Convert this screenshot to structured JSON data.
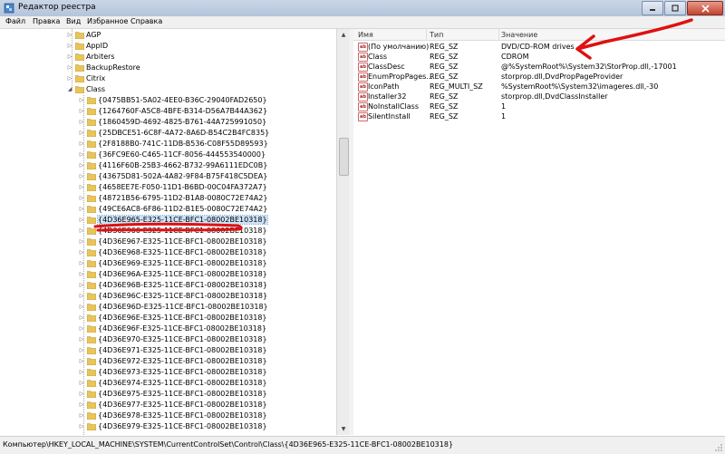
{
  "window": {
    "title": "Редактор реестра"
  },
  "menu": [
    "Файл",
    "Правка",
    "Вид",
    "Избранное",
    "Справка"
  ],
  "tree": {
    "items": [
      {
        "label": "AGP"
      },
      {
        "label": "AppID"
      },
      {
        "label": "Arbiters"
      },
      {
        "label": "BackupRestore"
      },
      {
        "label": "Citrix"
      },
      {
        "label": "Class"
      },
      {
        "label": "{0475BB51-5A02-4EE0-B36C-29040FAD2650}"
      },
      {
        "label": "{1264760F-A5C8-4BFE-B314-D56A7B44A362}"
      },
      {
        "label": "{1860459D-4692-4825-B761-44A725991050}"
      },
      {
        "label": "{25DBCE51-6C8F-4A72-8A6D-B54C2B4FC835}"
      },
      {
        "label": "{2F8188B0-741C-11DB-B536-C08F55D89593}"
      },
      {
        "label": "{36FC9E60-C465-11CF-8056-444553540000}"
      },
      {
        "label": "{4116F60B-25B3-4662-B732-99A6111EDC0B}"
      },
      {
        "label": "{43675D81-502A-4A82-9F84-B75F418C5DEA}"
      },
      {
        "label": "{4658EE7E-F050-11D1-B6BD-00C04FA372A7}"
      },
      {
        "label": "{48721B56-6795-11D2-B1A8-0080C72E74A2}"
      },
      {
        "label": "{49CE6AC8-6F86-11D2-B1E5-0080C72E74A2}"
      },
      {
        "label": "{4D36E965-E325-11CE-BFC1-08002BE10318}"
      },
      {
        "label": "{4D36E966-E325-11CE-BFC1-08002BE10318}"
      },
      {
        "label": "{4D36E967-E325-11CE-BFC1-08002BE10318}"
      },
      {
        "label": "{4D36E968-E325-11CE-BFC1-08002BE10318}"
      },
      {
        "label": "{4D36E969-E325-11CE-BFC1-08002BE10318}"
      },
      {
        "label": "{4D36E96A-E325-11CE-BFC1-08002BE10318}"
      },
      {
        "label": "{4D36E96B-E325-11CE-BFC1-08002BE10318}"
      },
      {
        "label": "{4D36E96C-E325-11CE-BFC1-08002BE10318}"
      },
      {
        "label": "{4D36E96D-E325-11CE-BFC1-08002BE10318}"
      },
      {
        "label": "{4D36E96E-E325-11CE-BFC1-08002BE10318}"
      },
      {
        "label": "{4D36E96F-E325-11CE-BFC1-08002BE10318}"
      },
      {
        "label": "{4D36E970-E325-11CE-BFC1-08002BE10318}"
      },
      {
        "label": "{4D36E971-E325-11CE-BFC1-08002BE10318}"
      },
      {
        "label": "{4D36E972-E325-11CE-BFC1-08002BE10318}"
      },
      {
        "label": "{4D36E973-E325-11CE-BFC1-08002BE10318}"
      },
      {
        "label": "{4D36E974-E325-11CE-BFC1-08002BE10318}"
      },
      {
        "label": "{4D36E975-E325-11CE-BFC1-08002BE10318}"
      },
      {
        "label": "{4D36E977-E325-11CE-BFC1-08002BE10318}"
      },
      {
        "label": "{4D36E978-E325-11CE-BFC1-08002BE10318}"
      },
      {
        "label": "{4D36E979-E325-11CE-BFC1-08002BE10318}"
      }
    ],
    "selected_label": "{4D36E965-E325-11CE-BFC1-08002BE10318}"
  },
  "values_pane": {
    "columns": [
      "Имя",
      "Тип",
      "Значение"
    ],
    "rows": [
      {
        "name": "(По умолчанию)",
        "type": "REG_SZ",
        "value": "DVD/CD-ROM drives"
      },
      {
        "name": "Class",
        "type": "REG_SZ",
        "value": "CDROM"
      },
      {
        "name": "ClassDesc",
        "type": "REG_SZ",
        "value": "@%SystemRoot%\\System32\\StorProp.dll,-17001"
      },
      {
        "name": "EnumPropPages...",
        "type": "REG_SZ",
        "value": "storprop.dll,DvdPropPageProvider"
      },
      {
        "name": "IconPath",
        "type": "REG_MULTI_SZ",
        "value": "%SystemRoot%\\System32\\imageres.dll,-30"
      },
      {
        "name": "Installer32",
        "type": "REG_SZ",
        "value": "storprop.dll,DvdClassInstaller"
      },
      {
        "name": "NoInstallClass",
        "type": "REG_SZ",
        "value": "1"
      },
      {
        "name": "SilentInstall",
        "type": "REG_SZ",
        "value": "1"
      }
    ]
  },
  "status": {
    "path": "Компьютер\\HKEY_LOCAL_MACHINE\\SYSTEM\\CurrentControlSet\\Control\\Class\\{4D36E965-E325-11CE-BFC1-08002BE10318}"
  },
  "colors": {
    "annotation_red": "#e01010",
    "selection_bg": "#cde3f7",
    "folder": "#e8c45a"
  },
  "icons": {
    "folder": "folder-icon",
    "string_value": "reg-string-icon",
    "app": "regedit-icon"
  }
}
